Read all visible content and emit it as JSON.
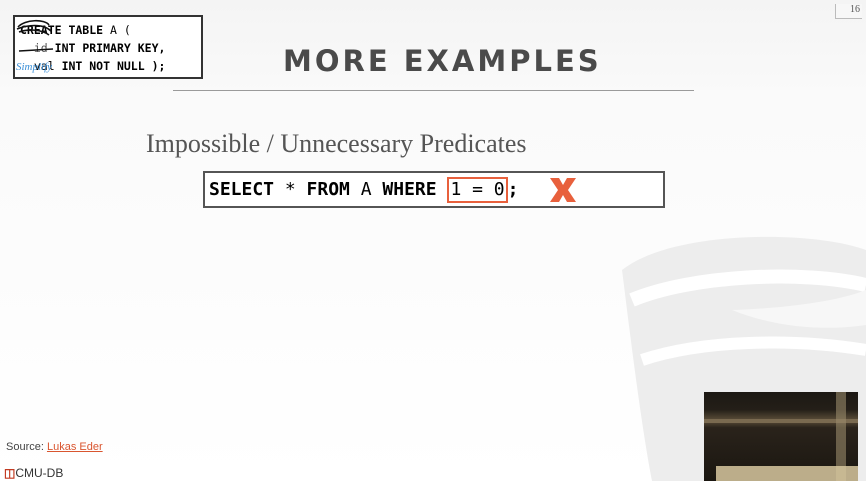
{
  "slide_number": "16",
  "sql_box": {
    "line1_kw": "CREATE TABLE",
    "line1_rest": " A (",
    "line2_kw": "id",
    "line2_rest": " INT PRIMARY KEY,",
    "line3_kw": "val",
    "line3_rest": " INT NOT NULL );",
    "annotation": "Simplify"
  },
  "title": "MORE EXAMPLES",
  "subtitle": "Impossible / Unnecessary Predicates",
  "query": {
    "part1": "SELECT",
    "part2": " * ",
    "part3": "FROM",
    "part4": " A ",
    "part5": "WHERE",
    "part6": " ",
    "highlight": "1 = 0",
    "part7": ";"
  },
  "source": {
    "label": "Source: ",
    "link": "Lukas Eder"
  },
  "footer_logo": "CMU-DB",
  "colors": {
    "accent": "#e8603c",
    "title": "#4a4a4a",
    "link": "#d9552f"
  },
  "icons": [
    "x-mark-icon",
    "database-logo-icon",
    "cmu-db-logo-icon"
  ]
}
